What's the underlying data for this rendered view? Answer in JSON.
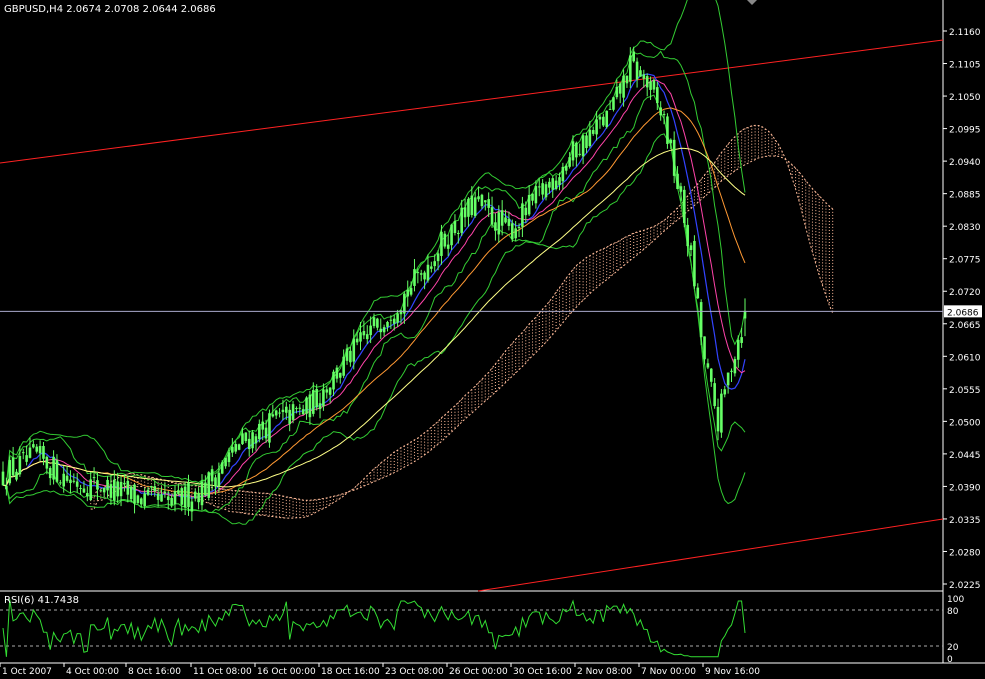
{
  "window": {
    "symbol_info": "GBPUSD,H4  2.0674 2.0708 2.0644 2.0686"
  },
  "price_axis": {
    "labels": [
      "2.1160",
      "2.1105",
      "2.1050",
      "2.0995",
      "2.0940",
      "2.0885",
      "2.0830",
      "2.0775",
      "2.0720",
      "2.0665",
      "2.0610",
      "2.0555",
      "2.0500",
      "2.0445",
      "2.0390",
      "2.0335",
      "2.0280",
      "2.0225"
    ],
    "current_price": "2.0686"
  },
  "rsi_panel": {
    "title": "RSI(6) 41.7438",
    "levels": [
      "100",
      "80",
      "20",
      "0"
    ]
  },
  "time_axis": {
    "labels": [
      "1 Oct 2007",
      "4 Oct 00:00",
      "8 Oct 16:00",
      "11 Oct 08:00",
      "16 Oct 00:00",
      "18 Oct 16:00",
      "23 Oct 08:00",
      "26 Oct 00:00",
      "30 Oct 16:00",
      "2 Nov 08:00",
      "7 Nov 00:00",
      "9 Nov 16:00"
    ]
  },
  "colors": {
    "background": "#000000",
    "candles": "#66ff66",
    "bollinger": "#33cc33",
    "trendline": "#ff2222",
    "ma_blue": "#3344ff",
    "ma_magenta": "#ff44aa",
    "ma_orange": "#ff9933",
    "ma_yellow": "#ffff88",
    "ichimoku_cloud": "#ffbb99",
    "rsi_line": "#33dd33",
    "price_line": "#aaaacc"
  },
  "chart_data": {
    "type": "candlestick",
    "title": "GBPUSD,H4",
    "ylim": [
      2.022,
      2.121
    ],
    "anchors_close": [
      [
        0,
        2.041
      ],
      [
        10,
        2.044
      ],
      [
        20,
        2.04
      ],
      [
        30,
        2.039
      ],
      [
        40,
        2.037
      ],
      [
        50,
        2.036
      ],
      [
        60,
        2.039
      ],
      [
        70,
        2.046
      ],
      [
        80,
        2.05
      ],
      [
        90,
        2.052
      ],
      [
        100,
        2.059
      ],
      [
        110,
        2.066
      ],
      [
        120,
        2.072
      ],
      [
        130,
        2.08
      ],
      [
        140,
        2.087
      ],
      [
        150,
        2.082
      ],
      [
        160,
        2.089
      ],
      [
        170,
        2.096
      ],
      [
        180,
        2.102
      ],
      [
        186,
        2.11
      ],
      [
        190,
        2.108
      ],
      [
        196,
        2.101
      ],
      [
        200,
        2.09
      ],
      [
        204,
        2.078
      ],
      [
        208,
        2.06
      ],
      [
        212,
        2.05
      ],
      [
        216,
        2.06
      ],
      [
        220,
        2.068
      ]
    ],
    "current_price": 2.0686,
    "rsi_last": 41.7438
  }
}
